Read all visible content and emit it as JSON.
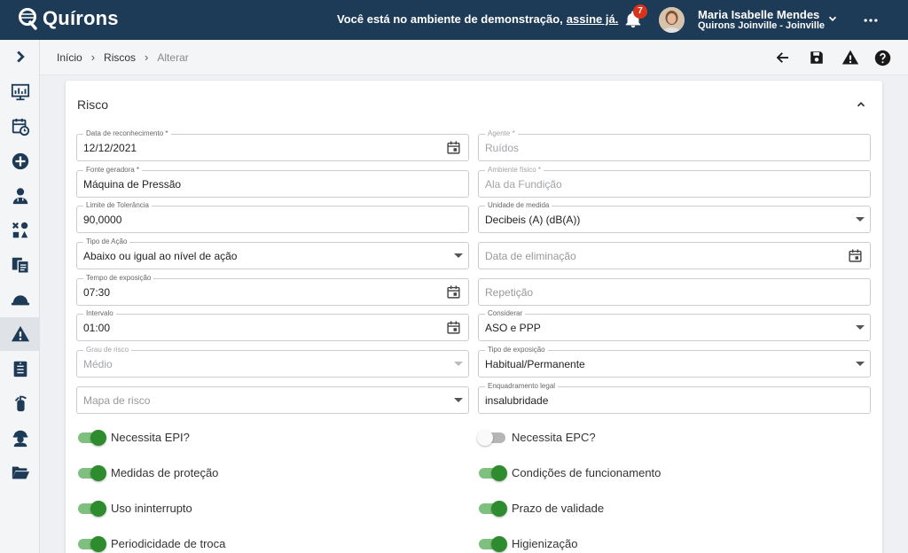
{
  "header": {
    "brand": "Quírons",
    "demo_message": "Você está no ambiente de demonstração,",
    "demo_link": "assine já.",
    "notification_count": "7",
    "user_name": "Maria Isabelle Mendes",
    "user_company": "Quirons Joinville - Joinville"
  },
  "sidebar": {
    "items": [
      {
        "icon": "chevron-right-icon"
      },
      {
        "icon": "dashboard-icon"
      },
      {
        "icon": "calendar-clock-icon"
      },
      {
        "icon": "add-circle-icon"
      },
      {
        "icon": "doctor-icon"
      },
      {
        "icon": "shapes-icon"
      },
      {
        "icon": "documents-icon"
      },
      {
        "icon": "helmet-icon"
      },
      {
        "icon": "warning-icon",
        "active": true
      },
      {
        "icon": "clipboard-icon"
      },
      {
        "icon": "extinguisher-icon"
      },
      {
        "icon": "worker-icon"
      },
      {
        "icon": "folder-icon"
      }
    ]
  },
  "breadcrumb": {
    "home": "Início",
    "section": "Riscos",
    "current": "Alterar"
  },
  "card": {
    "title": "Risco"
  },
  "form": {
    "data_reconhecimento": {
      "label": "Data de reconhecimento *",
      "value": "12/12/2021"
    },
    "agente": {
      "label": "Agente *",
      "value": "Ruídos"
    },
    "fonte_geradora": {
      "label": "Fonte geradora *",
      "value": "Máquina de Pressão"
    },
    "ambiente_fisico": {
      "label": "Ambiente físico *",
      "value": "Ala da Fundição"
    },
    "limite_tolerancia": {
      "label": "Limite de Tolerância",
      "value": "90,0000"
    },
    "unidade_medida": {
      "label": "Unidade de medida",
      "value": "Decibeis (A) (dB(A))"
    },
    "tipo_acao": {
      "label": "Tipo de Ação",
      "value": "Abaixo ou igual ao nível de ação"
    },
    "data_eliminacao": {
      "placeholder": "Data de eliminação"
    },
    "tempo_exposicao": {
      "label": "Tempo de exposição",
      "value": "07:30"
    },
    "repeticao": {
      "placeholder": "Repetição"
    },
    "intervalo": {
      "label": "Intervalo",
      "value": "01:00"
    },
    "considerar": {
      "label": "Considerar",
      "value": "ASO e PPP"
    },
    "grau_risco": {
      "label": "Grau de risco",
      "value": "Médio"
    },
    "tipo_exposicao": {
      "label": "Tipo de exposição",
      "value": "Habitual/Permanente"
    },
    "mapa_risco": {
      "placeholder": "Mapa de risco"
    },
    "enquadramento_legal": {
      "label": "Enquadramento legal",
      "value": "insalubridade"
    }
  },
  "toggles": [
    {
      "label": "Necessita EPI?",
      "on": true
    },
    {
      "label": "Necessita EPC?",
      "on": false
    },
    {
      "label": "Medidas de proteção",
      "on": true
    },
    {
      "label": "Condições de funcionamento",
      "on": true
    },
    {
      "label": "Uso ininterrupto",
      "on": true
    },
    {
      "label": "Prazo de validade",
      "on": true
    },
    {
      "label": "Periodicidade de troca",
      "on": true
    },
    {
      "label": "Higienização",
      "on": true
    }
  ],
  "colors": {
    "header_bg": "#1d3a57",
    "toggle_on": "#2e8b2e",
    "badge": "#d9331b"
  }
}
